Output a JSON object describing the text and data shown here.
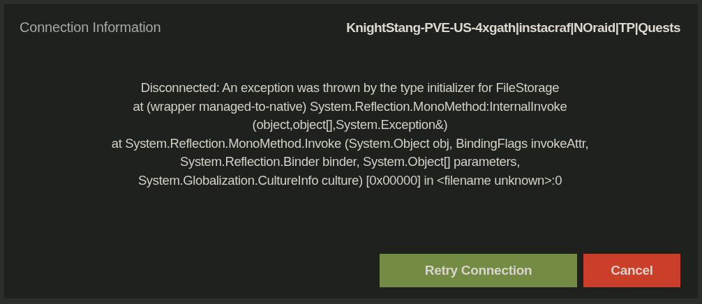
{
  "dialog": {
    "title": "Connection Information",
    "server_name": "KnightStang-PVE-US-4xgath|instacraf|NOraid|TP|Quests",
    "message_lines": [
      "Disconnected: An exception was thrown by the type initializer for FileStorage",
      "at (wrapper managed-to-native) System.Reflection.MonoMethod:InternalInvoke",
      "(object,object[],System.Exception&)",
      "at System.Reflection.MonoMethod.Invoke (System.Object obj, BindingFlags invokeAttr,",
      "System.Reflection.Binder binder, System.Object[] parameters,",
      "System.Globalization.CultureInfo culture) [0x00000] in <filename unknown>:0"
    ],
    "buttons": [
      {
        "label": "Retry Connection",
        "kind": "confirm"
      },
      {
        "label": "Cancel",
        "kind": "cancel"
      }
    ]
  }
}
